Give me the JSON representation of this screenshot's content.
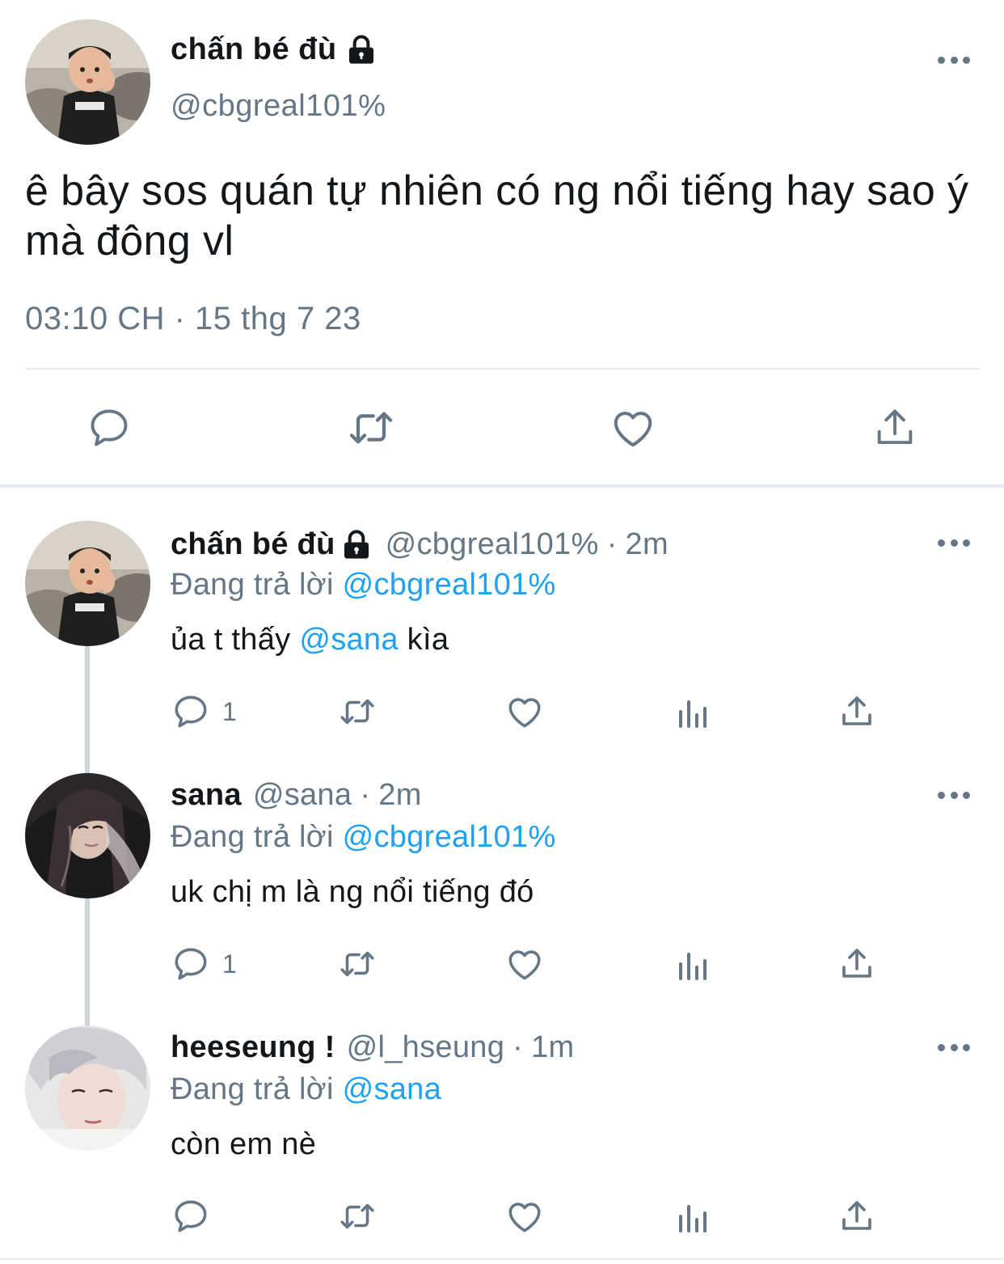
{
  "main_tweet": {
    "name": "chấn bé đù",
    "handle": "@cbgreal101%",
    "text": "ê bây sos quán tự nhiên có ng nổi tiếng hay sao ý mà đông vl",
    "timestamp": "03:10 CH · 15 thg 7 23",
    "actions": [
      "reply-icon",
      "retweet-icon",
      "like-icon",
      "share-icon"
    ]
  },
  "replies": [
    {
      "name": "chấn bé đù",
      "locked": true,
      "handle": "@cbgreal101%",
      "dot": "·",
      "time": "2m",
      "replying_prefix": "Đang trả lời",
      "replying_to": "@cbgreal101%",
      "text_before": "ủa t thấy",
      "text_mention": "@sana",
      "text_after": "kìa",
      "reply_count": "1"
    },
    {
      "name": "sana",
      "locked": false,
      "handle": "@sana",
      "dot": "·",
      "time": "2m",
      "replying_prefix": "Đang trả lời",
      "replying_to": "@cbgreal101%",
      "text": "uk chị m là ng nổi tiếng đó",
      "reply_count": "1"
    },
    {
      "name": "heeseung !",
      "locked": false,
      "handle": "@l_hseung",
      "dot": "·",
      "time": "1m",
      "replying_prefix": "Đang trả lời",
      "replying_to": "@sana",
      "text": "còn em nè",
      "reply_count": ""
    }
  ],
  "colors": {
    "text": "#14171a",
    "secondary": "#657786",
    "link": "#1da1f2",
    "divider": "#e6ecf0",
    "thread_line": "#ccd6dd"
  }
}
